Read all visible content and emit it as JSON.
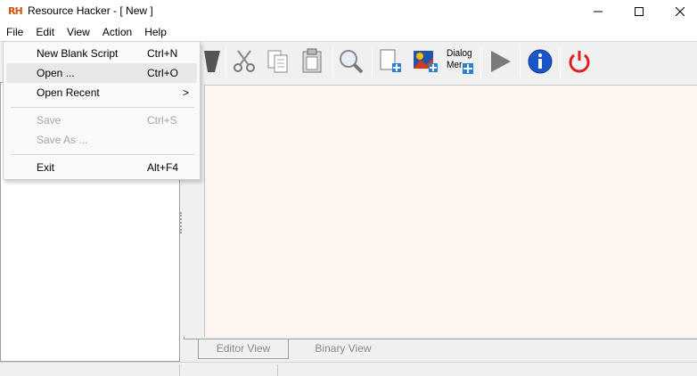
{
  "window": {
    "title": "Resource Hacker - [ New ]",
    "icon_text": "RH"
  },
  "menubar": {
    "items": [
      "File",
      "Edit",
      "View",
      "Action",
      "Help"
    ]
  },
  "file_menu": {
    "items": [
      {
        "label": "New Blank Script",
        "shortcut": "Ctrl+N",
        "enabled": true
      },
      {
        "label": "Open ...",
        "shortcut": "Ctrl+O",
        "enabled": true
      },
      {
        "label": "Open Recent",
        "shortcut": "",
        "enabled": true,
        "arrow": ">"
      },
      {
        "label": "Save",
        "shortcut": "Ctrl+S",
        "enabled": false
      },
      {
        "label": "Save As ...",
        "shortcut": "",
        "enabled": false
      },
      {
        "label": "Exit",
        "shortcut": "Alt+F4",
        "enabled": true
      }
    ]
  },
  "toolbar": {
    "dialog_label_line1": "Dialog",
    "dialog_label_line2": "Mer",
    "icons": [
      "compile-icon",
      "cut-icon",
      "copy-icon",
      "paste-icon",
      "find-icon",
      "add-blank-resource-icon",
      "add-image-resource-icon",
      "dialog-merger-icon",
      "run-icon",
      "info-icon",
      "exit-power-icon"
    ]
  },
  "tabs": {
    "editor": "Editor View",
    "binary": "Binary View"
  },
  "colors": {
    "editor_bg": "#fcf6ef",
    "power_red": "#e02020",
    "info_blue": "#1a56c8",
    "run_gray": "#7a7a7a"
  }
}
